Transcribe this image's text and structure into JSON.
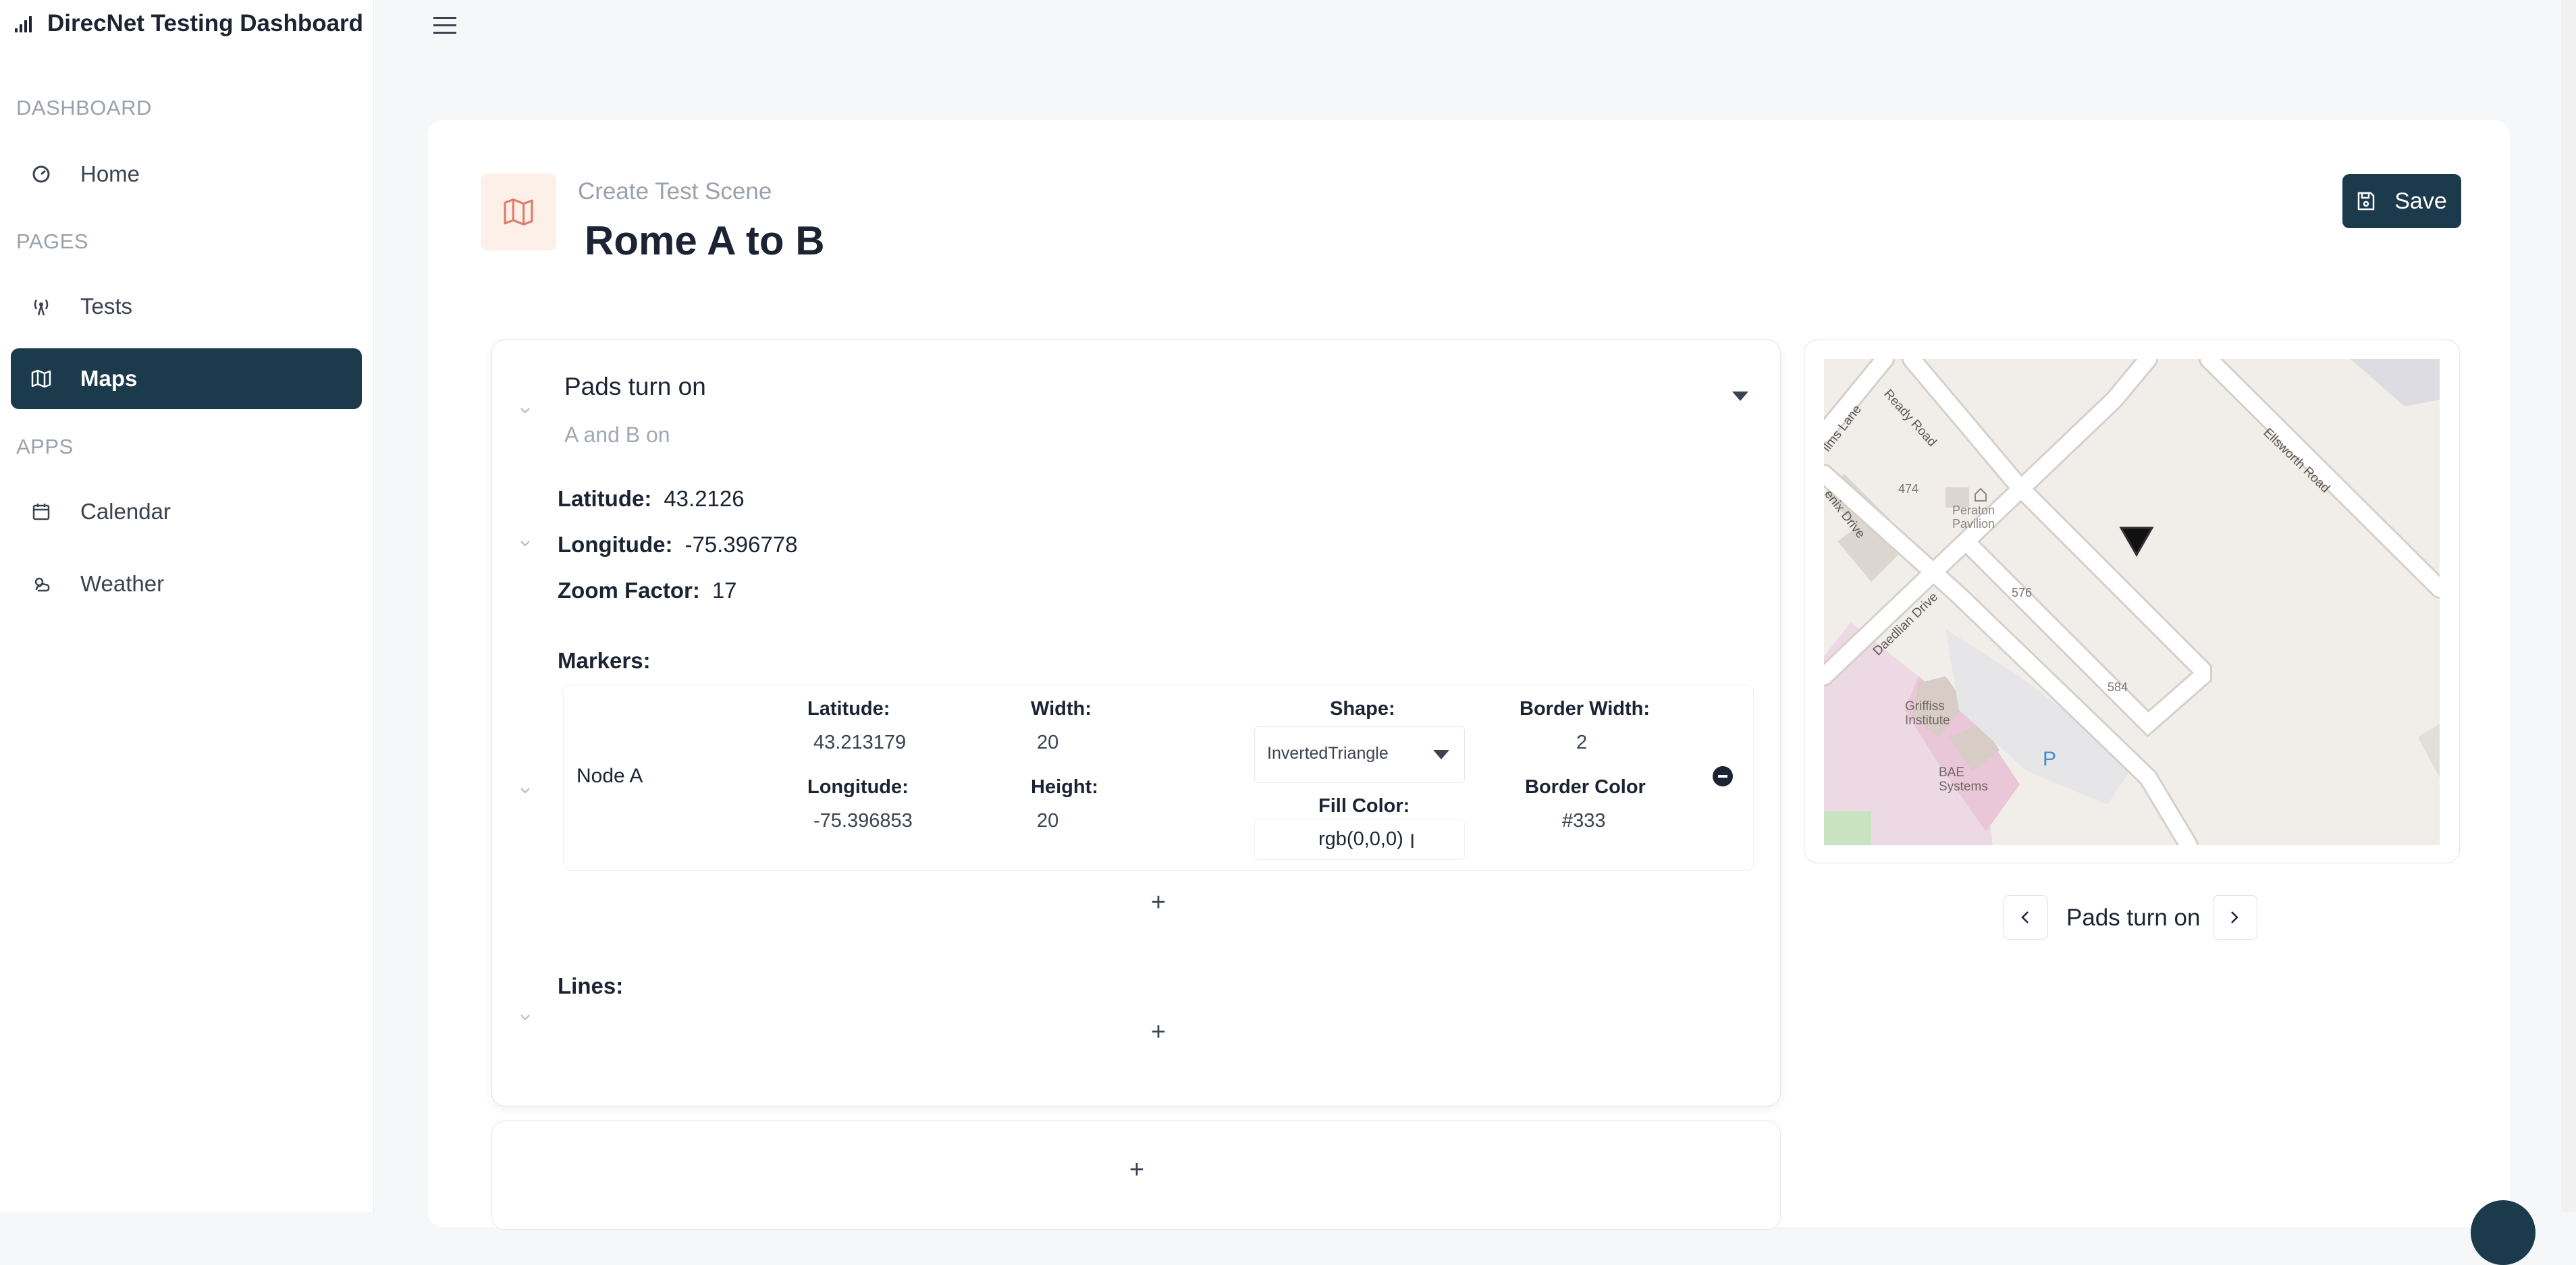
{
  "app": {
    "title": "DirecNet Testing Dashboard"
  },
  "sidebar": {
    "sections": [
      {
        "label": "DASHBOARD"
      },
      {
        "label": "PAGES"
      },
      {
        "label": "APPS"
      }
    ],
    "items": [
      {
        "label": "Home",
        "icon": "gauge-icon"
      },
      {
        "label": "Tests",
        "icon": "antenna-icon"
      },
      {
        "label": "Maps",
        "icon": "map-icon",
        "active": true
      },
      {
        "label": "Calendar",
        "icon": "calendar-icon"
      },
      {
        "label": "Weather",
        "icon": "weather-icon"
      }
    ]
  },
  "header": {
    "eyebrow": "Create Test Scene",
    "title": "Rome A to B",
    "save_label": "Save"
  },
  "scene": {
    "title": "Pads turn on",
    "subtitle": "A and B on",
    "latitude_label": "Latitude:",
    "latitude": "43.2126",
    "longitude_label": "Longitude:",
    "longitude": "-75.396778",
    "zoom_label": "Zoom Factor:",
    "zoom": "17",
    "markers_label": "Markers:",
    "lines_label": "Lines:",
    "add_symbol": "+"
  },
  "marker": {
    "name": "Node A",
    "latitude_label": "Latitude:",
    "latitude": "43.213179",
    "longitude_label": "Longitude:",
    "longitude": "-75.396853",
    "width_label": "Width:",
    "width": "20",
    "height_label": "Height:",
    "height": "20",
    "shape_label": "Shape:",
    "shape": "InvertedTriangle",
    "fill_label": "Fill Color:",
    "fill": "rgb(0,0,0)",
    "border_width_label": "Border Width:",
    "border_width": "2",
    "border_color_label": "Border Color",
    "border_color": "#333"
  },
  "map": {
    "labels": {
      "ready_road": "Ready Road",
      "ellsworth_road": "Ellsworth Road",
      "mills_lane": "llms Lane",
      "lenox_drive": "enix Drive",
      "daedalian_drive": "Daedlian Drive",
      "num_474": "474",
      "num_576": "576",
      "num_584": "584",
      "peraton": "Peraton Pavilion",
      "griffiss": "Griffiss Institute",
      "bae": "BAE Systems",
      "parking": "P"
    },
    "nav_label": "Pads turn on"
  },
  "colors": {
    "accent": "#1b3a4b",
    "page_bg": "#f6f7f9",
    "muted": "#9aa1ad"
  }
}
